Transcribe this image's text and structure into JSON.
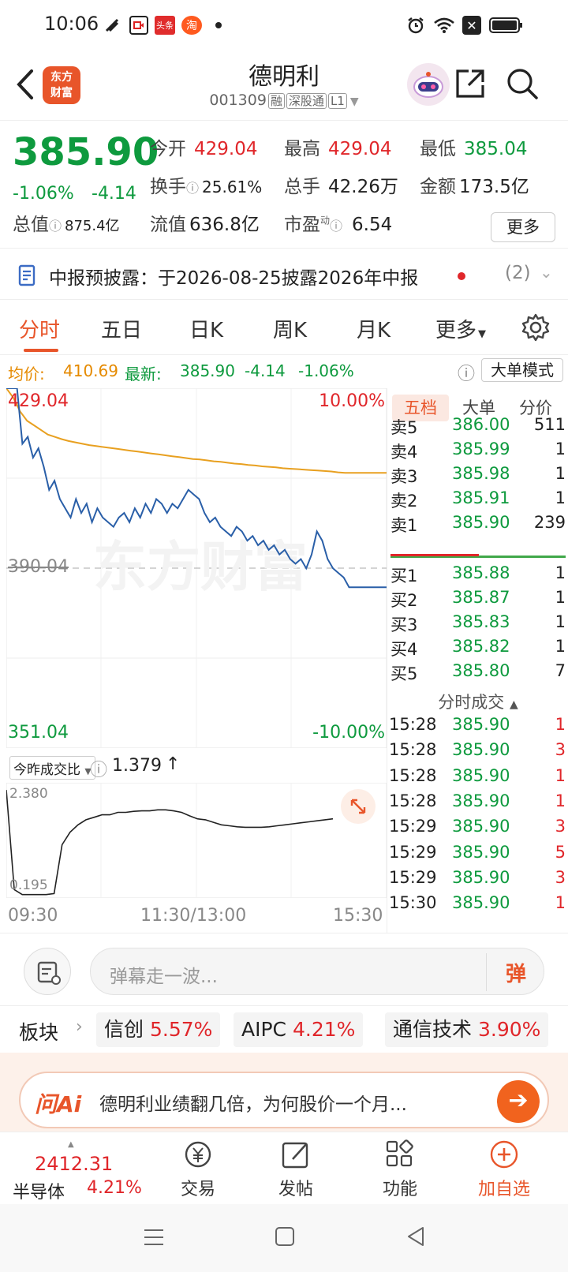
{
  "status_bar": {
    "time": "10:06",
    "badge1": "头条",
    "badge2": "淘"
  },
  "header": {
    "title": "德明利",
    "code": "001309",
    "tags": [
      "融",
      "深股通",
      "L1"
    ],
    "logo_line1": "东方",
    "logo_line2": "财富"
  },
  "quote": {
    "price": "385.90",
    "change_pct": "-1.06%",
    "change": "-4.14",
    "open_label": "今开",
    "open": "429.04",
    "high_label": "最高",
    "high": "429.04",
    "low_label": "最低",
    "low": "385.04",
    "turnover_label": "换手",
    "turnover": "25.61%",
    "volume_label": "总手",
    "volume": "42.26万",
    "amount_label": "金额",
    "amount": "173.5亿",
    "mktcap_label": "总值",
    "mktcap": "875.4亿",
    "float_label": "流值",
    "float": "636.8亿",
    "pe_label": "市盈",
    "pe_sup": "动",
    "pe": "6.54",
    "more_label": "更多"
  },
  "notice": {
    "text": "中报预披露：于2026-08-25披露2026年中报",
    "count": "(2)"
  },
  "tabs": [
    "分时",
    "五日",
    "日K",
    "周K",
    "月K",
    "更多"
  ],
  "info_bar": {
    "avg_label": "均价:",
    "avg": "410.69",
    "latest_label": "最新:",
    "latest": "385.90",
    "change": "-4.14",
    "change_pct": "-1.06%",
    "big_mode": "大单模式"
  },
  "chart_data": {
    "type": "line",
    "y_max_label": "429.04",
    "y_mid_label": "390.04",
    "y_min_label": "351.04",
    "pct_max_label": "10.00%",
    "pct_min_label": "-10.00%",
    "ylim": [
      351.04,
      429.04
    ],
    "prev_close": 390.04,
    "watermark": "东方财富",
    "x_labels": [
      "09:30",
      "11:30/13:00",
      "15:30"
    ],
    "series": [
      {
        "values": [
          429.04,
          429.04,
          429.04,
          417,
          418.5,
          414,
          416,
          412,
          407,
          409,
          405,
          403,
          401,
          405,
          402,
          404,
          400,
          403,
          401,
          400,
          399,
          401,
          402,
          400,
          403,
          401,
          404,
          402,
          405,
          404,
          402,
          404,
          403,
          405,
          407,
          406,
          405,
          402,
          400,
          401,
          399,
          398,
          397,
          399,
          398,
          396,
          397,
          395,
          396,
          394,
          395,
          393,
          394,
          392,
          391,
          392,
          390,
          393,
          398,
          396,
          392,
          390,
          389,
          388,
          385.9,
          385.9,
          385.9,
          385.9,
          385.9,
          385.9,
          385.9,
          385.9
        ]
      },
      {
        "values": [
          429.04,
          427,
          424,
          422,
          421,
          420,
          419,
          418.5,
          418,
          417.6,
          417.3,
          417,
          416.7,
          416.5,
          416.3,
          416.1,
          415.9,
          415.7,
          415.5,
          415.3,
          415.1,
          414.9,
          414.7,
          414.5,
          414.3,
          414.1,
          413.9,
          413.7,
          413.6,
          413.4,
          413.2,
          413.1,
          412.9,
          412.7,
          412.6,
          412.4,
          412.3,
          412.1,
          412,
          411.9,
          411.7,
          411.6,
          411.5,
          411.4,
          411.3,
          411.2,
          411.1,
          411,
          410.8,
          410.69,
          410.69,
          410.69,
          410.69,
          410.69,
          410.69,
          410.69
        ]
      }
    ]
  },
  "sub_chart": {
    "selector": "今昨成交比",
    "value": "1.379",
    "top_label": "2.380",
    "bottom_label": "0.195",
    "values": [
      2.3,
      0.3,
      0.2,
      0.2,
      0.2,
      0.2,
      0.22,
      1.2,
      1.45,
      1.6,
      1.7,
      1.75,
      1.8,
      1.8,
      1.85,
      1.85,
      1.87,
      1.88,
      1.88,
      1.9,
      1.9,
      1.88,
      1.85,
      1.78,
      1.72,
      1.7,
      1.65,
      1.6,
      1.58,
      1.56,
      1.55,
      1.55,
      1.55,
      1.56,
      1.58,
      1.6,
      1.62,
      1.64,
      1.66,
      1.68,
      1.7,
      1.72
    ]
  },
  "book": {
    "tabs": [
      "五档",
      "大单",
      "分价"
    ],
    "asks": [
      {
        "label": "卖5",
        "price": "386.00",
        "qty": "511"
      },
      {
        "label": "卖4",
        "price": "385.99",
        "qty": "1"
      },
      {
        "label": "卖3",
        "price": "385.98",
        "qty": "1"
      },
      {
        "label": "卖2",
        "price": "385.91",
        "qty": "1"
      },
      {
        "label": "卖1",
        "price": "385.90",
        "qty": "239"
      }
    ],
    "bids": [
      {
        "label": "买1",
        "price": "385.88",
        "qty": "1"
      },
      {
        "label": "买2",
        "price": "385.87",
        "qty": "1"
      },
      {
        "label": "买3",
        "price": "385.83",
        "qty": "1"
      },
      {
        "label": "买4",
        "price": "385.82",
        "qty": "1"
      },
      {
        "label": "买5",
        "price": "385.80",
        "qty": "7"
      }
    ],
    "trades_header": "分时成交",
    "trades": [
      {
        "time": "15:28",
        "price": "385.90",
        "qty": "1",
        "color": "#e0262a"
      },
      {
        "time": "15:28",
        "price": "385.90",
        "qty": "3",
        "color": "#e0262a"
      },
      {
        "time": "15:28",
        "price": "385.90",
        "qty": "1",
        "color": "#e0262a"
      },
      {
        "time": "15:28",
        "price": "385.90",
        "qty": "1",
        "color": "#e0262a"
      },
      {
        "time": "15:29",
        "price": "385.90",
        "qty": "3",
        "color": "#e0262a"
      },
      {
        "time": "15:29",
        "price": "385.90",
        "qty": "5",
        "color": "#e0262a"
      },
      {
        "time": "15:29",
        "price": "385.90",
        "qty": "3",
        "color": "#e0262a"
      },
      {
        "time": "15:30",
        "price": "385.90",
        "qty": "1",
        "color": "#e0262a"
      }
    ]
  },
  "danmu": {
    "placeholder": "弹幕走一波...",
    "send_label": "弹"
  },
  "sector": {
    "label": "板块",
    "chips": [
      {
        "name": "信创",
        "pct": "5.57%"
      },
      {
        "name": "AIPC",
        "pct": "4.21%"
      },
      {
        "name": "通信技术",
        "pct": "3.90%"
      }
    ]
  },
  "ai": {
    "logo": "问Ai",
    "question": "德明利业绩翻几倍，为何股价一个月..."
  },
  "bottom_nav": {
    "index_value": "2412.31",
    "index_name": "半导体",
    "index_pct": "4.21%",
    "items": [
      "交易",
      "发帖",
      "功能",
      "加自选"
    ]
  },
  "colors": {
    "up": "#e0262a",
    "down": "#0e9a3e",
    "accent": "#e8552a",
    "price_line": "#2a5fa8",
    "avg_line": "#e8a020"
  }
}
